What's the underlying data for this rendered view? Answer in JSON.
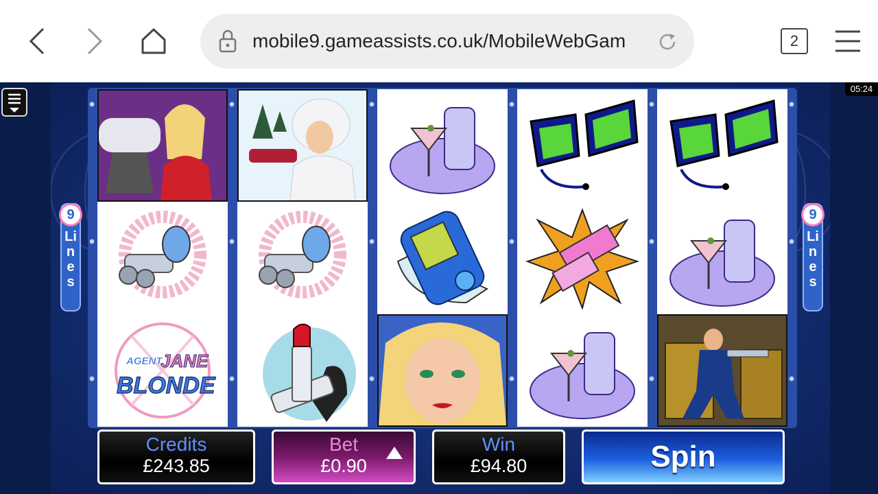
{
  "browser": {
    "url": "mobile9.gameassists.co.uk/MobileWebGam",
    "tab_count": "2",
    "icons": [
      "back-icon",
      "forward-icon",
      "home-icon",
      "lock-icon",
      "reload-icon",
      "menu-icon"
    ]
  },
  "status": {
    "time": "05:24"
  },
  "game": {
    "lines": {
      "count": "9",
      "word": "Lines"
    },
    "reels": [
      [
        "jane-plane",
        "furry-handcuffs",
        "agent-jane-blonde-logo"
      ],
      [
        "jane-snow",
        "furry-handcuffs",
        "lipstick"
      ],
      [
        "cocktail-shaker",
        "gadget-pager",
        "jane-face"
      ],
      [
        "spy-glasses",
        "explosive-gum",
        "cocktail-shaker"
      ],
      [
        "spy-glasses",
        "cocktail-shaker",
        "jane-action"
      ]
    ],
    "logo": {
      "line1": "AGENT",
      "line2": "JANE",
      "line3": "BLONDE"
    },
    "credits": {
      "label": "Credits",
      "value": "£243.85"
    },
    "bet": {
      "label": "Bet",
      "value": "£0.90"
    },
    "win": {
      "label": "Win",
      "value": "£94.80"
    },
    "spin_label": "Spin",
    "colors": {
      "accent": "#2f63c8",
      "bet": "#d14cc3",
      "frame": "#2b4ea8"
    }
  }
}
